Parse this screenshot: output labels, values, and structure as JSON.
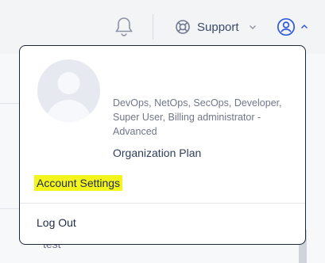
{
  "topbar": {
    "notifications_icon": "bell-icon",
    "support_label": "Support",
    "support_icon": "lifebuoy-icon",
    "user_icon": "user-circle-icon"
  },
  "background": {
    "row_text": "test"
  },
  "dropdown": {
    "roles": "DevOps, NetOps, SecOps, Developer, Super User, Billing administrator - Advanced",
    "plan": "Organization Plan",
    "account_settings": "Account Settings",
    "logout": "Log Out"
  },
  "colors": {
    "highlight": "#f4f51c",
    "border": "#1d2738"
  }
}
